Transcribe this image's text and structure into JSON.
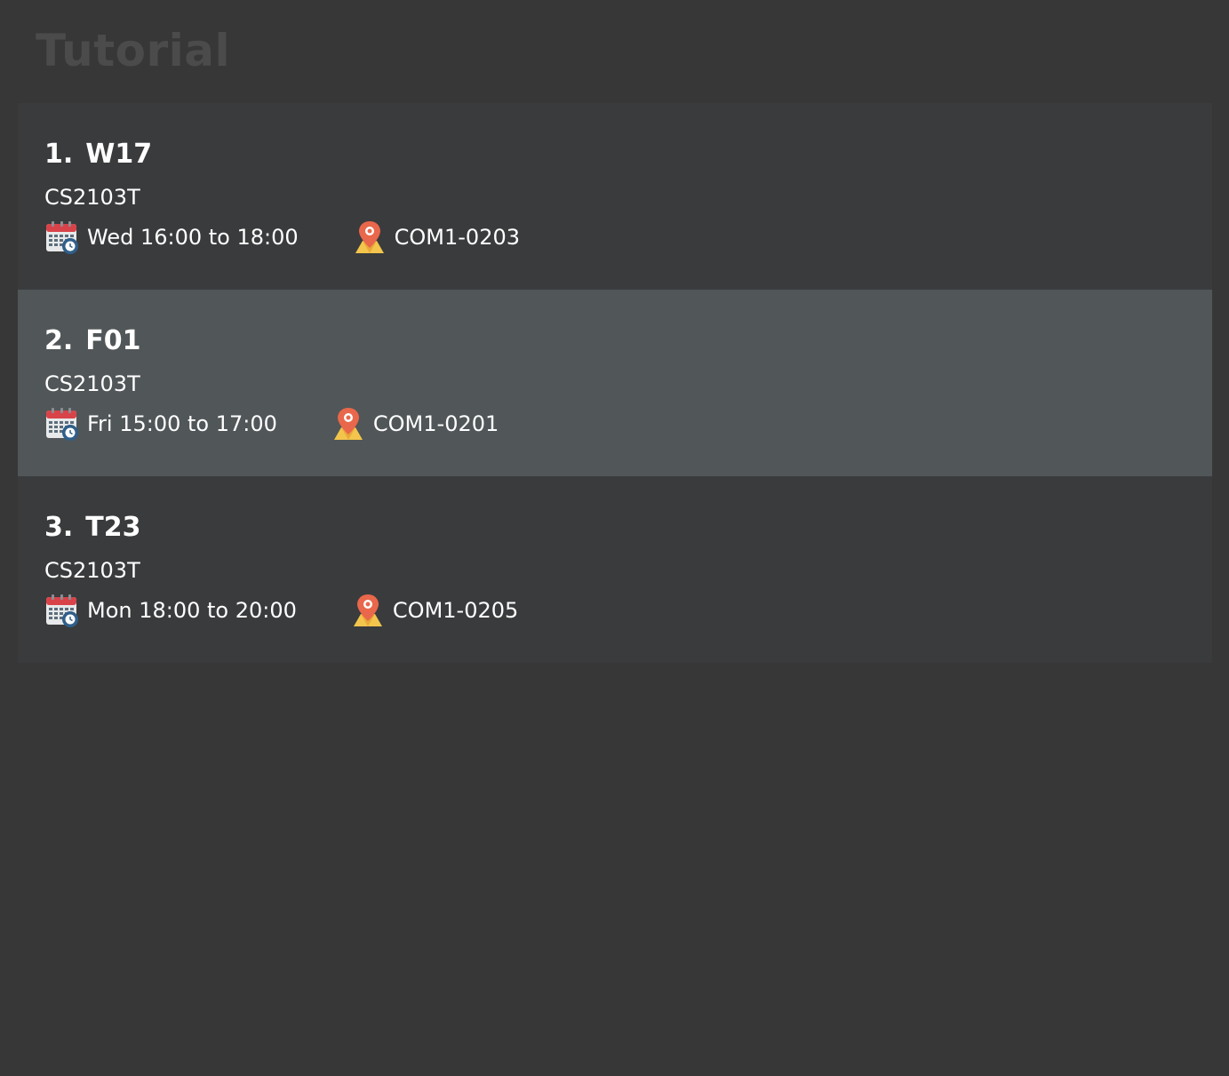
{
  "page": {
    "title": "Tutorial"
  },
  "tutorials": [
    {
      "index": "1.",
      "name": "W17",
      "module": "CS2103T",
      "time": "Wed 16:00 to 18:00",
      "venue": "COM1-0203",
      "calendar_icon": "calendar-icon",
      "venue_icon": "location-pin-icon",
      "selected": false
    },
    {
      "index": "2.",
      "name": "F01",
      "module": "CS2103T",
      "time": "Fri 15:00 to 17:00",
      "venue": "COM1-0201",
      "calendar_icon": "calendar-icon",
      "venue_icon": "location-pin-icon",
      "selected": true
    },
    {
      "index": "3.",
      "name": "T23",
      "module": "CS2103T",
      "time": "Mon 18:00 to 20:00",
      "venue": "COM1-0205",
      "calendar_icon": "calendar-icon",
      "venue_icon": "location-pin-icon",
      "selected": false
    }
  ],
  "colors": {
    "background": "#373737",
    "card": "#3a3b3d",
    "card_selected": "#515658",
    "title_text": "#4b4b4b",
    "text": "#ffffff"
  }
}
